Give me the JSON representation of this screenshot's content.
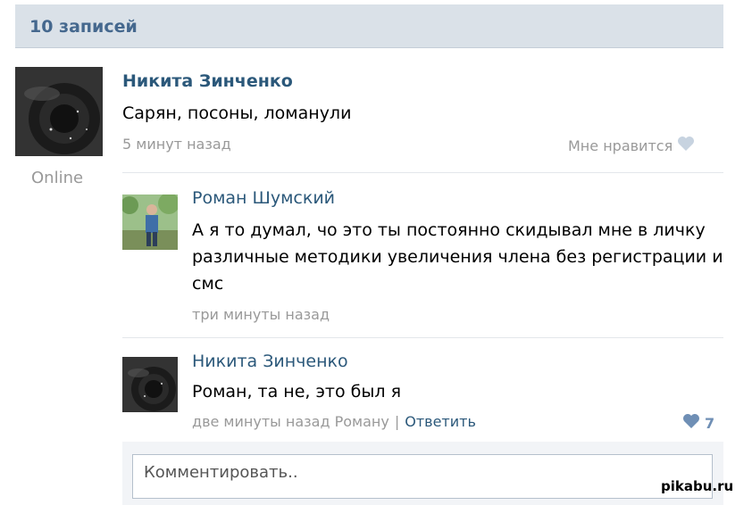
{
  "header": {
    "title": "10 записей"
  },
  "post": {
    "author": "Никита Зинченко",
    "text": "Сарян, посоны, ломанули",
    "time": "5 минут назад",
    "like_label": "Мне нравится",
    "online": "Online"
  },
  "comments": [
    {
      "author": "Роман Шумский",
      "text_lines": [
        "А я то думал, чо это ты постоянно скидывал мне в личку",
        "различные методики увеличения члена без регистрации и",
        "смс"
      ],
      "time": "три минуты назад"
    },
    {
      "author": "Никита Зинченко",
      "text": "Роман, та не, это был я",
      "time": "две минуты назад Роману",
      "reply_label": "Ответить",
      "like_count": "7"
    }
  ],
  "comment_box": {
    "placeholder": "Комментировать.."
  },
  "watermark": "pikabu.ru",
  "colors": {
    "link": "#2b587a",
    "header_bg": "#dae1e8",
    "meta": "#999999",
    "heart_active": "#6f8fb5",
    "heart_idle": "#c7d3e0"
  }
}
